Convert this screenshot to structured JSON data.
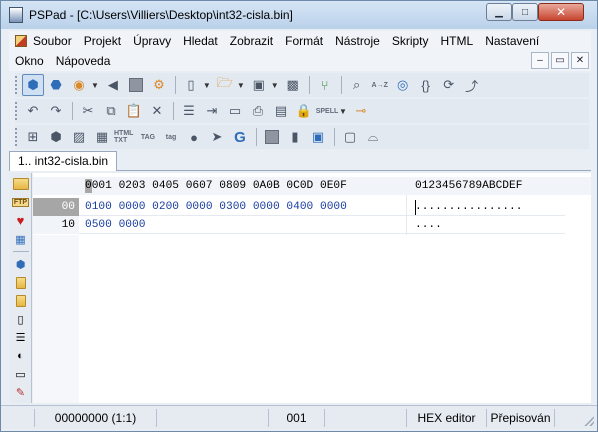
{
  "window": {
    "title": "PSPad - [C:\\Users\\Villiers\\Desktop\\int32-cisla.bin]",
    "minimize": "▁",
    "maximize": "□",
    "close": "✕"
  },
  "menu": {
    "row1": [
      "Soubor",
      "Projekt",
      "Úpravy",
      "Hledat",
      "Zobrazit",
      "Formát",
      "Nástroje",
      "Skripty",
      "HTML",
      "Nastavení"
    ],
    "row2": [
      "Okno",
      "Nápoveda"
    ],
    "mdi": [
      "–",
      "▭",
      "✕"
    ]
  },
  "toolbars": {
    "spell_label": "SPELL",
    "html_label": "HTML\nTXT",
    "tag_label": "TAG",
    "tag2_label": "tag",
    "g_label": "G"
  },
  "tabs": [
    {
      "label": "1.. int32-cisla.bin",
      "active": true
    }
  ],
  "sidebar": {
    "ftp_label": "FTP"
  },
  "hex_editor": {
    "header_hex": "0001 0203 0405 0607 0809 0A0B 0C0D 0E0F",
    "header_ascii": "0123456789ABCDEF",
    "rows": [
      {
        "offset": "00",
        "hex": "0100 0000 0200 0000 0300 0000 0400 0000",
        "ascii": "................"
      },
      {
        "offset": "10",
        "hex": "0500 0000",
        "ascii": "...."
      }
    ]
  },
  "status": {
    "position": "00000000  (1:1)",
    "blank1": "",
    "value": "001",
    "blank2": "",
    "mode": "HEX editor",
    "overwrite": "Přepisován"
  },
  "colors": {
    "hex_value": "#1a3ea0",
    "offset_selected_bg": "#a6a6a6"
  }
}
